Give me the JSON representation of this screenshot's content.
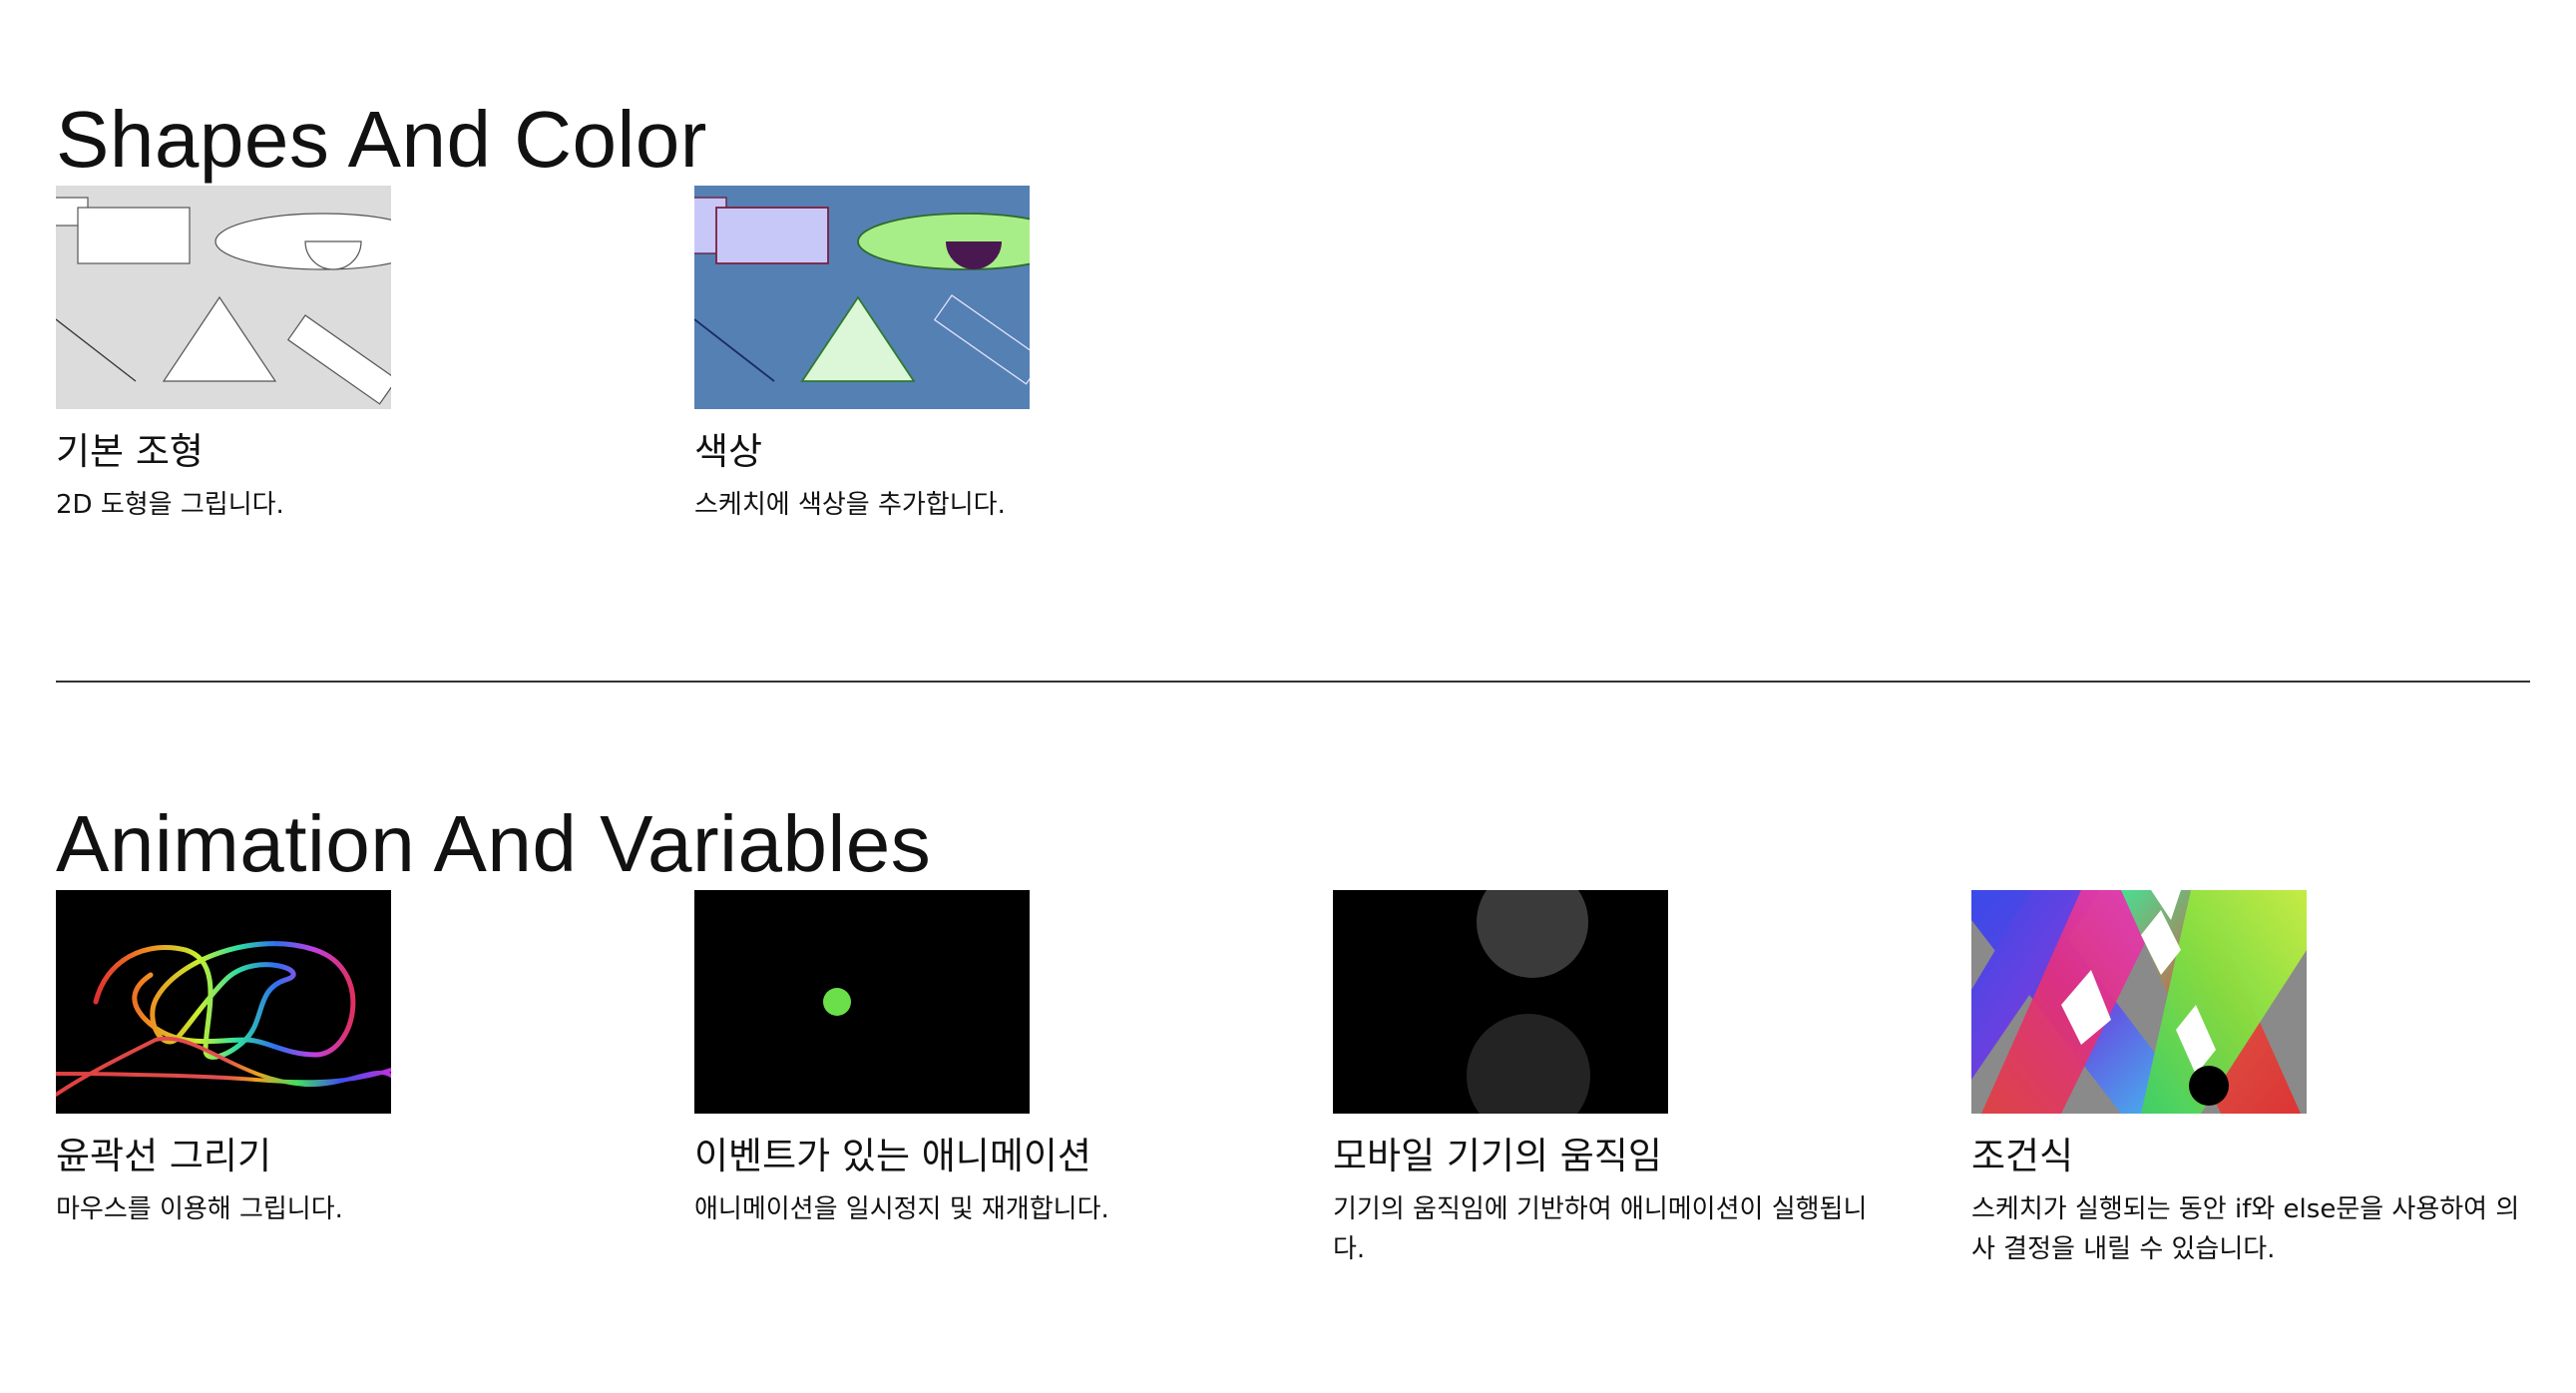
{
  "sections": [
    {
      "title": "Shapes And Color",
      "cards": [
        {
          "title": "기본 조형",
          "description": "2D 도형을 그립니다.",
          "thumbnail": "basic-shapes-sketch"
        },
        {
          "title": "색상",
          "description": "스케치에 색상을 추가합니다.",
          "thumbnail": "color-shapes-sketch"
        }
      ]
    },
    {
      "title": "Animation And Variables",
      "cards": [
        {
          "title": "윤곽선 그리기",
          "description": "마우스를 이용해 그립니다.",
          "thumbnail": "rainbow-drawing-sketch"
        },
        {
          "title": "이벤트가 있는 애니메이션",
          "description": "애니메이션을 일시정지 및 재개합니다.",
          "thumbnail": "green-dot-sketch"
        },
        {
          "title": "모바일 기기의 움직임",
          "description": "기기의 움직임에 기반하여 애니메이션이 실행됩니다.",
          "thumbnail": "gray-circles-sketch"
        },
        {
          "title": "조건식",
          "description": "스케치가 실행되는 동안 if와 else문을 사용하여 의사 결정을 내릴 수 있습니다.",
          "thumbnail": "gradient-bands-sketch"
        }
      ]
    }
  ],
  "colors": {
    "divider": "#333333",
    "shapes_bg": "#dcdcdc",
    "color_bg": "#5580b4",
    "lavender": "#c8c8f8",
    "light_green": "#a8ee88",
    "pale_green": "#dcf6d8",
    "purple": "#4a1850"
  }
}
